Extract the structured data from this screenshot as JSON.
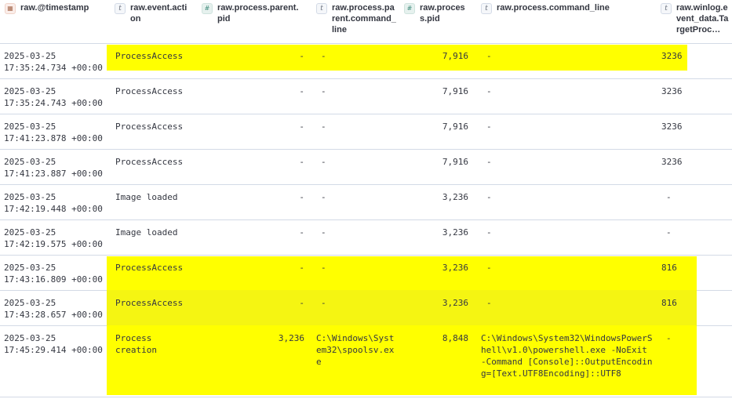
{
  "columns": [
    {
      "label": "raw.@timestamp",
      "type_icon": "calendar-icon",
      "type_glyph": "📅"
    },
    {
      "label": "raw.event.action",
      "type_icon": "text-type-icon",
      "type_glyph": "t"
    },
    {
      "label": "raw.process.parent.pid",
      "type_icon": "number-type-icon",
      "type_glyph": "#"
    },
    {
      "label": "raw.process.parent.command_line",
      "type_icon": "text-type-icon",
      "type_glyph": "t"
    },
    {
      "label": "raw.process.pid",
      "type_icon": "number-type-icon",
      "type_glyph": "#"
    },
    {
      "label": "raw.process.command_line",
      "type_icon": "text-type-icon",
      "type_glyph": "t"
    },
    {
      "label": "raw.winlog.event_data.TargetProc…",
      "type_icon": "text-type-icon",
      "type_glyph": "t"
    }
  ],
  "highlight_color": "#ffff00",
  "rows": [
    {
      "timestamp": "2025-03-25\n17:35:24.734 +00:00",
      "action": "ProcessAccess",
      "parent_pid": "-",
      "parent_cmd": "-",
      "pid": "7,916",
      "cmd": "-",
      "target": "3236",
      "highlighted": true
    },
    {
      "timestamp": "2025-03-25\n17:35:24.743 +00:00",
      "action": "ProcessAccess",
      "parent_pid": "-",
      "parent_cmd": "-",
      "pid": "7,916",
      "cmd": "-",
      "target": "3236",
      "highlighted": false
    },
    {
      "timestamp": "2025-03-25\n17:41:23.878 +00:00",
      "action": "ProcessAccess",
      "parent_pid": "-",
      "parent_cmd": "-",
      "pid": "7,916",
      "cmd": "-",
      "target": "3236",
      "highlighted": false
    },
    {
      "timestamp": "2025-03-25\n17:41:23.887 +00:00",
      "action": "ProcessAccess",
      "parent_pid": "-",
      "parent_cmd": "-",
      "pid": "7,916",
      "cmd": "-",
      "target": "3236",
      "highlighted": false
    },
    {
      "timestamp": "2025-03-25\n17:42:19.448 +00:00",
      "action": "Image loaded",
      "parent_pid": "-",
      "parent_cmd": "-",
      "pid": "3,236",
      "cmd": "-",
      "target": "-",
      "highlighted": false
    },
    {
      "timestamp": "2025-03-25\n17:42:19.575 +00:00",
      "action": "Image loaded",
      "parent_pid": "-",
      "parent_cmd": "-",
      "pid": "3,236",
      "cmd": "-",
      "target": "-",
      "highlighted": false
    },
    {
      "timestamp": "2025-03-25\n17:43:16.809 +00:00",
      "action": "ProcessAccess",
      "parent_pid": "-",
      "parent_cmd": "-",
      "pid": "3,236",
      "cmd": "-",
      "target": "816",
      "highlighted": true
    },
    {
      "timestamp": "2025-03-25\n17:43:28.657 +00:00",
      "action": "ProcessAccess",
      "parent_pid": "-",
      "parent_cmd": "-",
      "pid": "3,236",
      "cmd": "-",
      "target": "816",
      "highlighted": true
    },
    {
      "timestamp": "2025-03-25\n17:45:29.414 +00:00",
      "action": "Process\ncreation",
      "parent_pid": "3,236",
      "parent_cmd": "C:\\Windows\\System32\\spoolsv.exe",
      "pid": "8,848",
      "cmd": "C:\\Windows\\System32\\WindowsPowerShell\\v1.0\\powershell.exe -NoExit -Command [Console]::OutputEncoding=[Text.UTF8Encoding]::UTF8",
      "target": "-",
      "highlighted": true
    }
  ]
}
